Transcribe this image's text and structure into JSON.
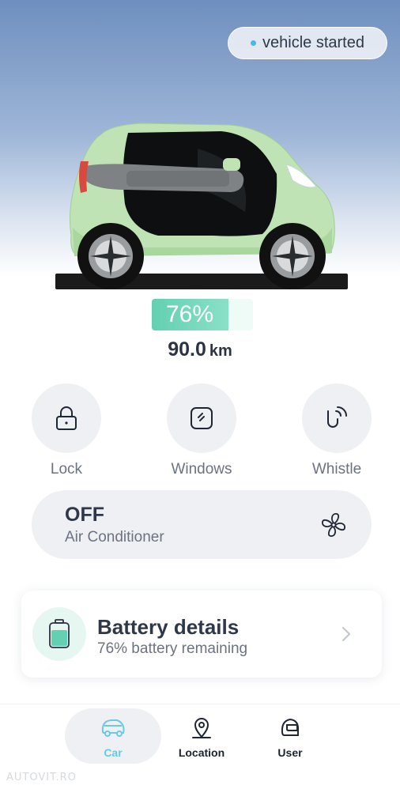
{
  "status": {
    "label": "vehicle started",
    "dot_color": "#4ab7e6"
  },
  "battery": {
    "percent_label": "76%",
    "level": 0.76,
    "range_value": "90.0",
    "range_unit": "km"
  },
  "controls": [
    {
      "label": "Lock",
      "icon": "lock-icon"
    },
    {
      "label": "Windows",
      "icon": "window-icon"
    },
    {
      "label": "Whistle",
      "icon": "whistle-icon"
    }
  ],
  "air_conditioner": {
    "state": "OFF",
    "label": "Air Conditioner",
    "icon": "fan-icon"
  },
  "battery_card": {
    "title": "Battery details",
    "subtitle": "76% battery remaining",
    "icon": "battery-icon"
  },
  "tabs": [
    {
      "label": "Car",
      "icon": "car-icon",
      "active": true
    },
    {
      "label": "Location",
      "icon": "location-pin-icon",
      "active": false
    },
    {
      "label": "User",
      "icon": "helmet-icon",
      "active": false
    }
  ],
  "watermark": "AUTOVIT.RO",
  "colors": {
    "accent": "#68c9e8",
    "battery": "#63d0b2",
    "car_body": "#bfe3b4"
  }
}
